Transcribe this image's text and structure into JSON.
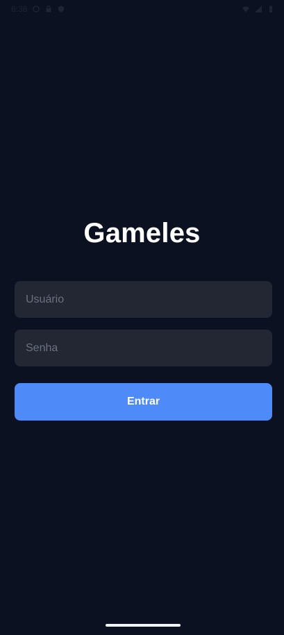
{
  "status_bar": {
    "time": "6:38",
    "left_icons": [
      "clock-icon",
      "lock-icon",
      "shield-icon"
    ],
    "right_icons": [
      "wifi-icon",
      "signal-icon",
      "battery-icon"
    ]
  },
  "app": {
    "title": "Gameles"
  },
  "form": {
    "username_placeholder": "Usuário",
    "password_placeholder": "Senha",
    "login_label": "Entrar"
  },
  "colors": {
    "background": "#0b1120",
    "field_background": "#232733",
    "primary": "#4f8bf8",
    "text": "#ffffff"
  }
}
